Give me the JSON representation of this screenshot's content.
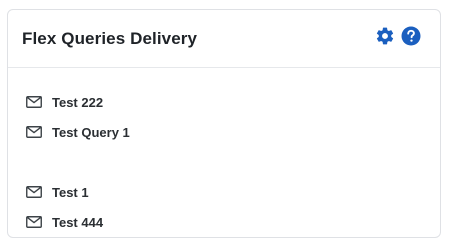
{
  "widget": {
    "title": "Flex Queries Delivery",
    "actions": {
      "settings_icon": "gear-icon",
      "help_icon": "question-circle-icon",
      "accent_color": "#1b5fbf"
    }
  },
  "deliveries": [
    {
      "label": "Test 222",
      "icon": "envelope-icon"
    },
    {
      "label": "Test Query 1",
      "icon": "envelope-icon"
    },
    {
      "label": "Test 1",
      "icon": "envelope-icon"
    },
    {
      "label": "Test 444",
      "icon": "envelope-icon"
    }
  ]
}
